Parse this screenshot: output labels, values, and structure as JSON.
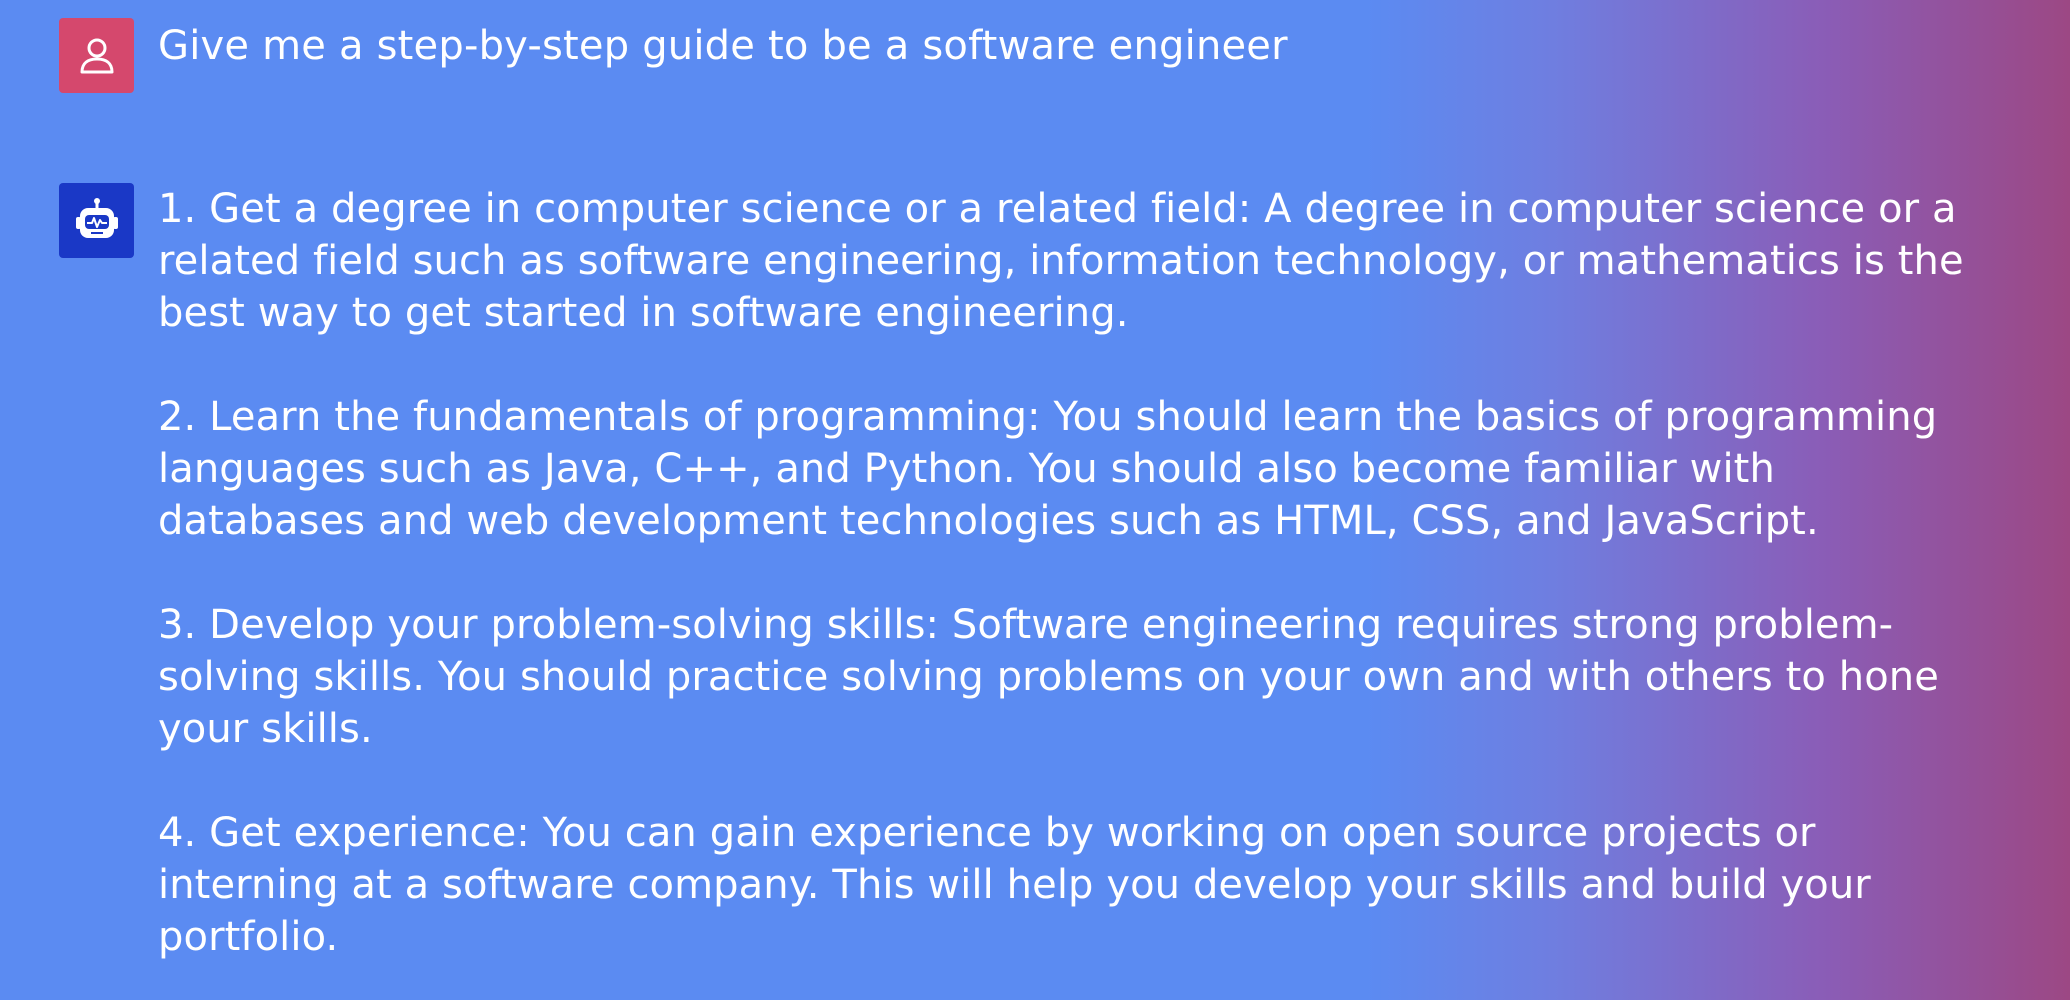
{
  "conversation": {
    "user_message": {
      "avatar_icon": "user-icon",
      "text": "Give me a step-by-step guide to be a software engineer"
    },
    "assistant_message": {
      "avatar_icon": "robot-icon",
      "steps": [
        " 1. Get a degree in computer science or a related field: A degree in computer science or a related field such as software engineering, information technology, or mathematics is the best way to get started in software engineering.",
        "2. Learn the fundamentals of programming: You should learn the basics of programming languages such as Java, C++, and Python. You should also become familiar with databases and web development technologies such as HTML, CSS, and JavaScript.",
        "3. Develop your problem-solving skills: Software engineering requires strong problem-solving skills. You should practice solving problems on your own and with others to hone your skills.",
        "4. Get experience: You can gain experience by working on open source projects or interning at a software company. This will help you develop your skills and build your portfolio."
      ]
    }
  },
  "colors": {
    "user_avatar_bg": "#d5486d",
    "assistant_avatar_bg": "#1a38c6",
    "background_left": "#5b8bf2",
    "background_right": "#9c4884",
    "text": "#ffffff"
  }
}
